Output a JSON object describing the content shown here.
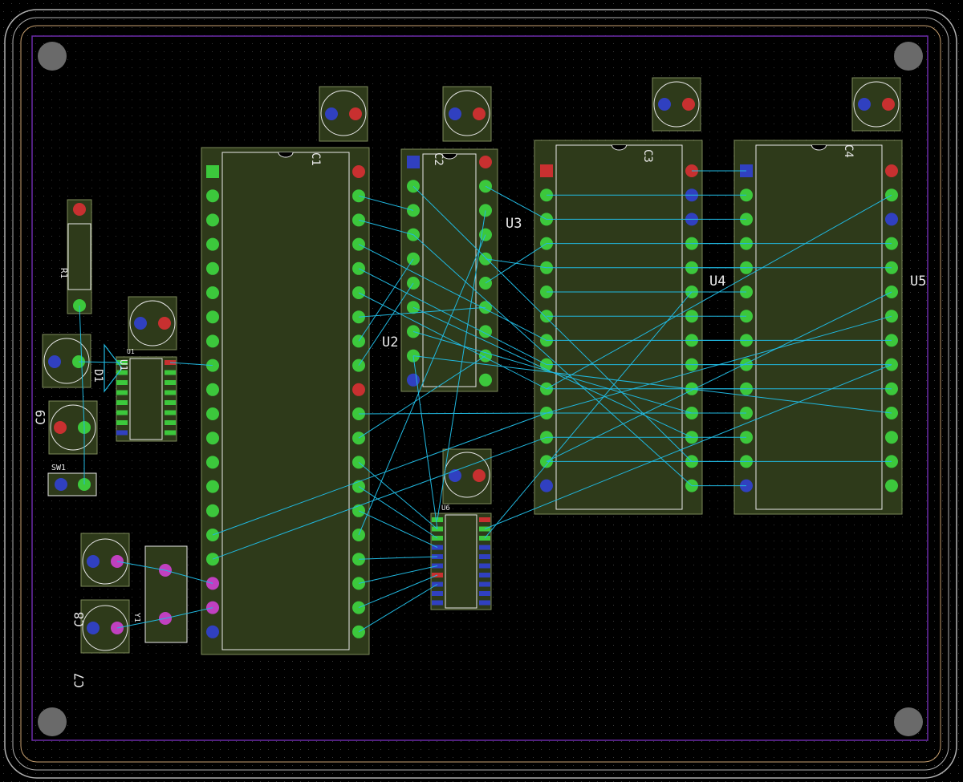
{
  "colors": {
    "background": "#000000",
    "grid_dot": "#3a3a3a",
    "board_edge": "#b0b0b0",
    "courtyard": "#c8a070",
    "keepout": "#6a2aa8",
    "footprint_fill": "#2e3a1a",
    "footprint_outline": "#7d8a5a",
    "silkscreen": "#e8e8e8",
    "pad_green": "#3cc83c",
    "pad_red": "#c83030",
    "pad_blue": "#3040c0",
    "pad_magenta": "#c040c0",
    "ratsnest": "#20b8e0",
    "mounting_hole": "#6a6a6a"
  },
  "references": {
    "u2": "U2",
    "u3": "U3",
    "u4": "U4",
    "u5": "U5",
    "u6": "U6",
    "c1": "C1",
    "c2": "C2",
    "c3": "C3",
    "c4": "C4",
    "c7": "C7",
    "c8": "C8",
    "c9": "C9",
    "r1": "R1",
    "d1": "D1",
    "sw1": "SW1",
    "y1": "Y1",
    "u1": "U1",
    "u1b": "U1"
  },
  "icons": {
    "mounting_hole": "mounting-hole-icon",
    "pin1_notch": "pin1-notch-icon",
    "diode_symbol": "diode-triangle-icon"
  }
}
